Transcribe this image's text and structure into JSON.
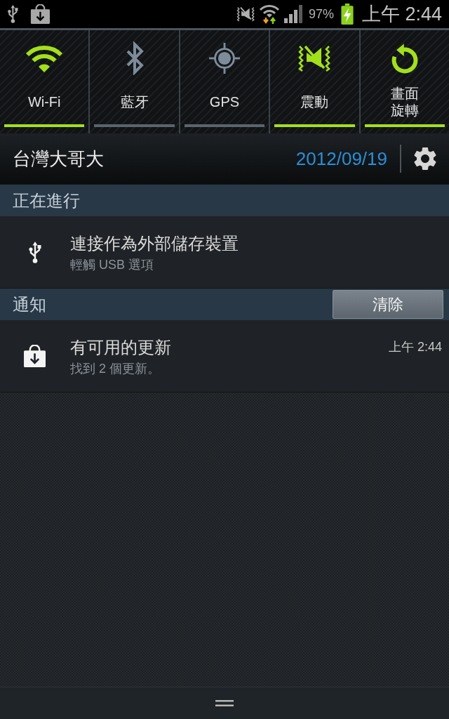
{
  "status_bar": {
    "battery_text": "97%",
    "time": "上午 2:44"
  },
  "quick_settings": [
    {
      "kind": "wifi",
      "label": "Wi-Fi",
      "on": true
    },
    {
      "kind": "bluetooth",
      "label": "藍牙",
      "on": false
    },
    {
      "kind": "gps",
      "label": "GPS",
      "on": false
    },
    {
      "kind": "vibrate",
      "label": "震動",
      "on": true
    },
    {
      "kind": "rotation",
      "label": "畫面旋轉",
      "on": true
    }
  ],
  "header": {
    "carrier": "台灣大哥大",
    "date": "2012/09/19"
  },
  "sections": [
    {
      "title": "正在進行",
      "items": [
        {
          "kind": "usb",
          "title": "連接作為外部儲存裝置",
          "subtitle": "輕觸 USB 選項"
        }
      ]
    },
    {
      "title": "通知",
      "button": "清除",
      "items": [
        {
          "kind": "update",
          "title": "有可用的更新",
          "subtitle": "找到 2 個更新。",
          "time": "上午 2:44"
        }
      ]
    }
  ]
}
